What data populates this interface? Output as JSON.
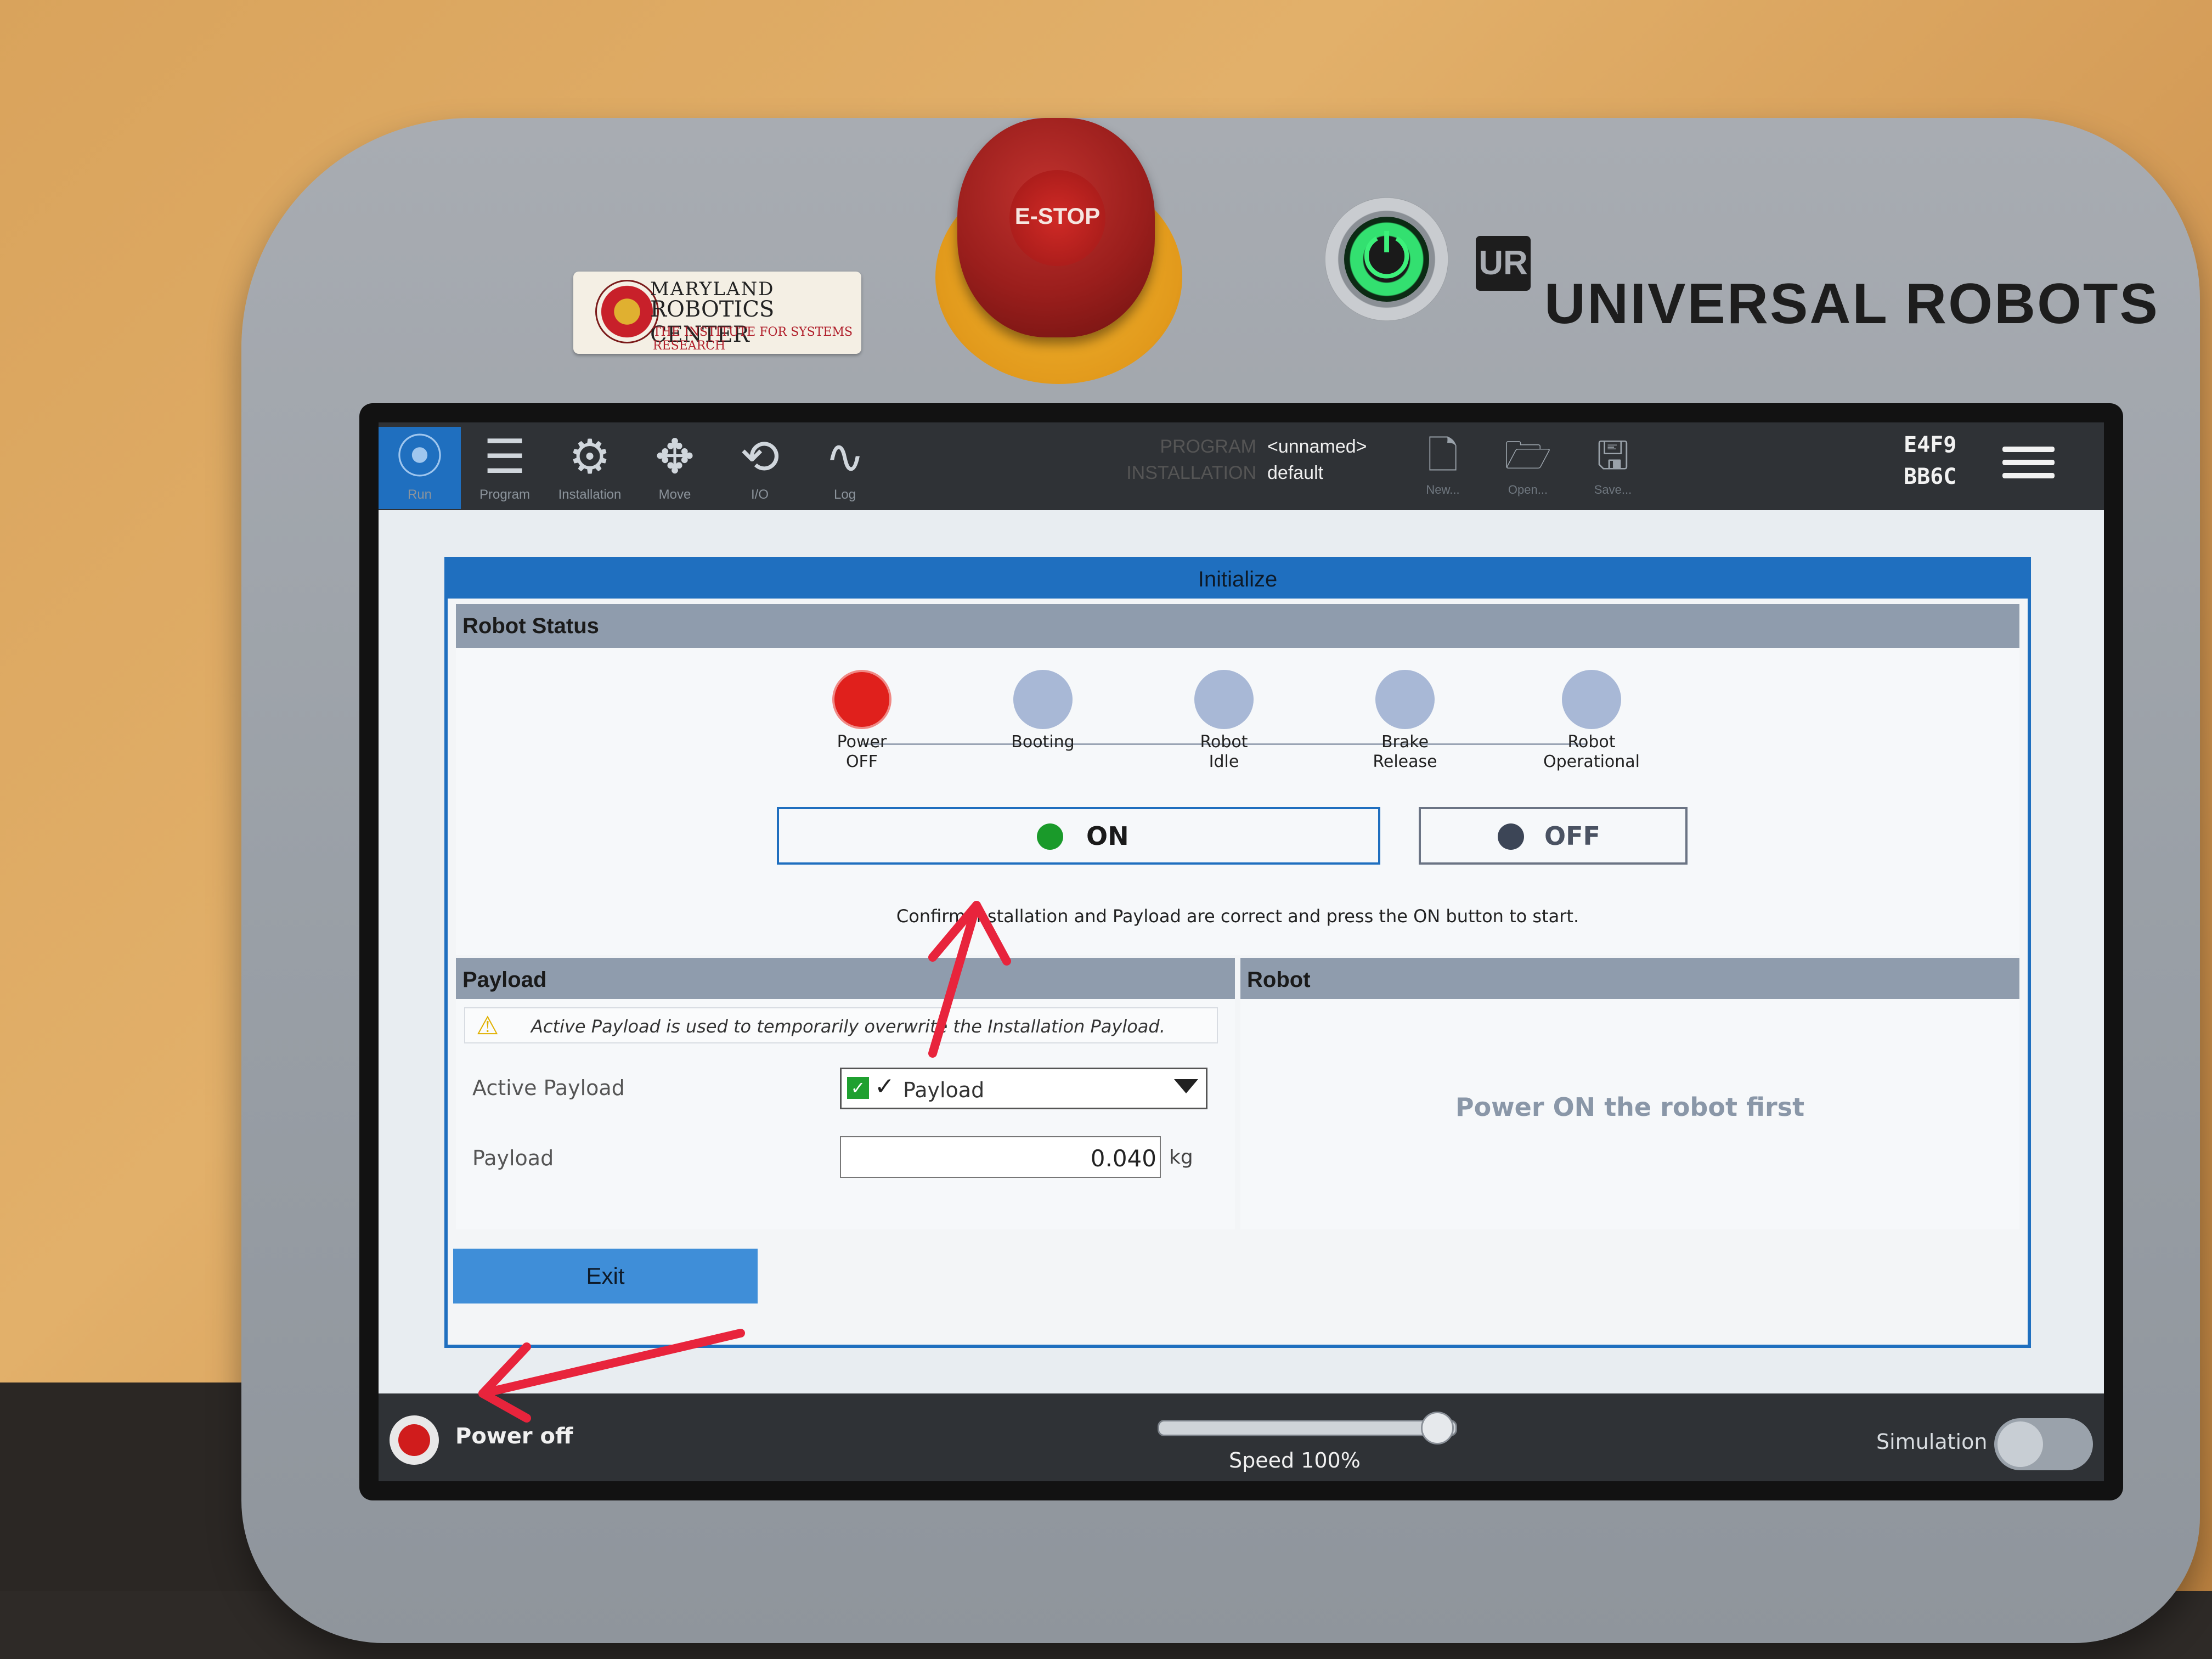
{
  "hardware": {
    "sticker": {
      "line1": "MARYLAND",
      "line2": "ROBOTICS CENTER",
      "line3": "THE INSTITUTE FOR SYSTEMS RESEARCH"
    },
    "estop_label": "E-STOP",
    "power_glyph": "⏻",
    "brand_mark": "UR",
    "brand": "UNIVERSAL ROBOTS"
  },
  "topbar": {
    "tabs": [
      {
        "label": "Run",
        "icon": "ur-logo-icon",
        "glyph": "⦿"
      },
      {
        "label": "Program",
        "icon": "program-icon",
        "glyph": "☰"
      },
      {
        "label": "Installation",
        "icon": "installation-icon",
        "glyph": "⚙"
      },
      {
        "label": "Move",
        "icon": "move-icon",
        "glyph": "✥"
      },
      {
        "label": "I/O",
        "icon": "io-icon",
        "glyph": "⟲"
      },
      {
        "label": "Log",
        "icon": "log-icon",
        "glyph": "∿"
      }
    ],
    "program_label": "PROGRAM",
    "installation_label": "INSTALLATION",
    "program_value": "<unnamed>",
    "installation_value": "default",
    "file_buttons": [
      {
        "label": "New...",
        "icon": "new-file-icon",
        "glyph": "🗋"
      },
      {
        "label": "Open...",
        "icon": "open-folder-icon",
        "glyph": "🗁"
      },
      {
        "label": "Save...",
        "icon": "save-icon",
        "glyph": "🖫"
      }
    ],
    "serial_line1": "E4F9",
    "serial_line2": "BB6C"
  },
  "dialog": {
    "title": "Initialize",
    "robot_status_title": "Robot Status",
    "steps": [
      {
        "label1": "Power",
        "label2": "OFF",
        "active": true
      },
      {
        "label1": "Booting",
        "label2": "",
        "active": false
      },
      {
        "label1": "Robot",
        "label2": "Idle",
        "active": false
      },
      {
        "label1": "Brake",
        "label2": "Release",
        "active": false
      },
      {
        "label1": "Robot",
        "label2": "Operational",
        "active": false
      }
    ],
    "on_label": "ON",
    "off_label": "OFF",
    "hint": "Confirm Installation and Payload are correct and press the ON button to start.",
    "payload_title": "Payload",
    "robot_title": "Robot",
    "warning": "Active Payload is used to temporarily overwrite the Installation Payload.",
    "active_payload_label": "Active Payload",
    "active_payload_value": "Payload",
    "payload_label": "Payload",
    "payload_value": "0.040",
    "payload_unit": "kg",
    "robot_message": "Power ON the robot first",
    "exit_label": "Exit"
  },
  "bottombar": {
    "power_label": "Power off",
    "speed_label": "Speed 100%",
    "speed_fraction": 1.0,
    "simulation_label": "Simulation",
    "simulation_on": false
  },
  "colors": {
    "accent": "#1f6fbf",
    "status_red": "#e0201c",
    "on_green": "#1a9a2a",
    "annotation_arrow": "#e8243c"
  }
}
